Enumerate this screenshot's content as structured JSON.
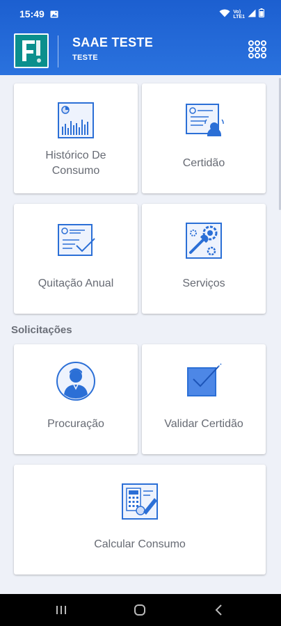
{
  "status_bar": {
    "time": "15:49",
    "volte_line1": "Vo)",
    "volte_line2": "LTE1"
  },
  "header": {
    "title": "SAAE TESTE",
    "subtitle": "TESTE",
    "logo_alt": "JF"
  },
  "services": [
    {
      "label": "Histórico De Consumo",
      "icon": "chart-icon"
    },
    {
      "label": "Certidão",
      "icon": "certificate-icon"
    },
    {
      "label": "Quitação Anual",
      "icon": "document-check-icon"
    },
    {
      "label": "Serviços",
      "icon": "tools-icon"
    }
  ],
  "requests_section": {
    "title": "Solicitações",
    "items": [
      {
        "label": "Procuração",
        "icon": "person-icon"
      },
      {
        "label": "Validar Certidão",
        "icon": "validate-icon"
      },
      {
        "label": "Calcular Consumo",
        "icon": "calculator-icon"
      }
    ]
  },
  "colors": {
    "header_blue": "#1c5fd0",
    "icon_blue": "#2b6fd6",
    "label_gray": "#666a73",
    "background": "#eef1f8"
  }
}
